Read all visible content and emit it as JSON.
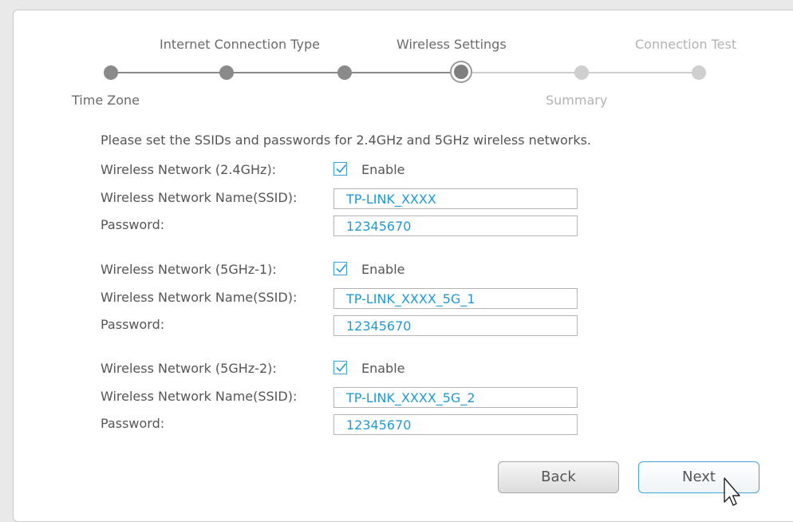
{
  "wizard": {
    "steps_top": [
      "Internet Connection Type",
      "Wireless Settings",
      "Connection Test"
    ],
    "steps_bottom": [
      "Time Zone",
      "Summary"
    ],
    "current_step": "Wireless Settings"
  },
  "intro": "Please set the SSIDs and passwords for 2.4GHz and 5GHz wireless networks.",
  "networks": [
    {
      "label": "Wireless Network (2.4GHz):",
      "enabled": true,
      "enable_label": "Enable",
      "ssid_label": "Wireless Network Name(SSID):",
      "ssid": "TP-LINK_XXXX",
      "password_label": "Password:",
      "password": "12345670"
    },
    {
      "label": "Wireless Network (5GHz-1):",
      "enabled": true,
      "enable_label": "Enable",
      "ssid_label": "Wireless Network Name(SSID):",
      "ssid": "TP-LINK_XXXX_5G_1",
      "password_label": "Password:",
      "password": "12345670"
    },
    {
      "label": "Wireless Network (5GHz-2):",
      "enabled": true,
      "enable_label": "Enable",
      "ssid_label": "Wireless Network Name(SSID):",
      "ssid": "TP-LINK_XXXX_5G_2",
      "password_label": "Password:",
      "password": "12345670"
    }
  ],
  "buttons": {
    "back": "Back",
    "next": "Next"
  },
  "colors": {
    "accent": "#1f9ad6",
    "checkbox_border": "#3aa0d8",
    "done_dot": "#8a8a8a",
    "future_dot": "#cfcfcf"
  }
}
